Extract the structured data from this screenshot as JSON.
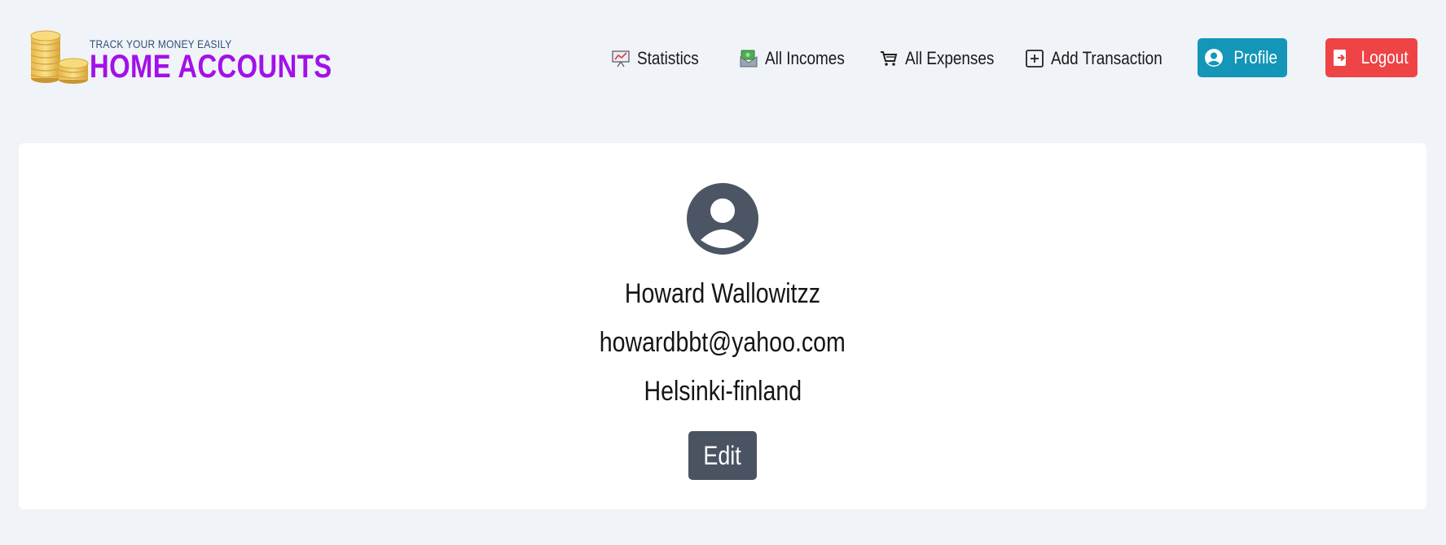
{
  "brand": {
    "tagline": "TRACK YOUR MONEY EASILY",
    "title": "HOME ACCOUNTS",
    "logo_icon": "coin-stack-icon",
    "title_color": "#a211e8"
  },
  "nav": {
    "statistics": {
      "label": "Statistics",
      "icon": "statistics-chart-icon"
    },
    "incomes": {
      "label": "All Incomes",
      "icon": "money-envelope-icon"
    },
    "expenses": {
      "label": "All Expenses",
      "icon": "shopping-cart-icon"
    },
    "add_transaction": {
      "label": "Add Transaction",
      "icon": "plus-square-icon"
    },
    "profile": {
      "label": "Profile",
      "icon": "user-circle-icon",
      "color": "#1396b8"
    },
    "logout": {
      "label": "Logout",
      "icon": "logout-icon",
      "color": "#ee4445"
    }
  },
  "profile": {
    "avatar_icon": "user-circle-icon",
    "name": "Howard Wallowitzz",
    "email": "howardbbt@yahoo.com",
    "location": "Helsinki-finland",
    "edit_label": "Edit"
  }
}
